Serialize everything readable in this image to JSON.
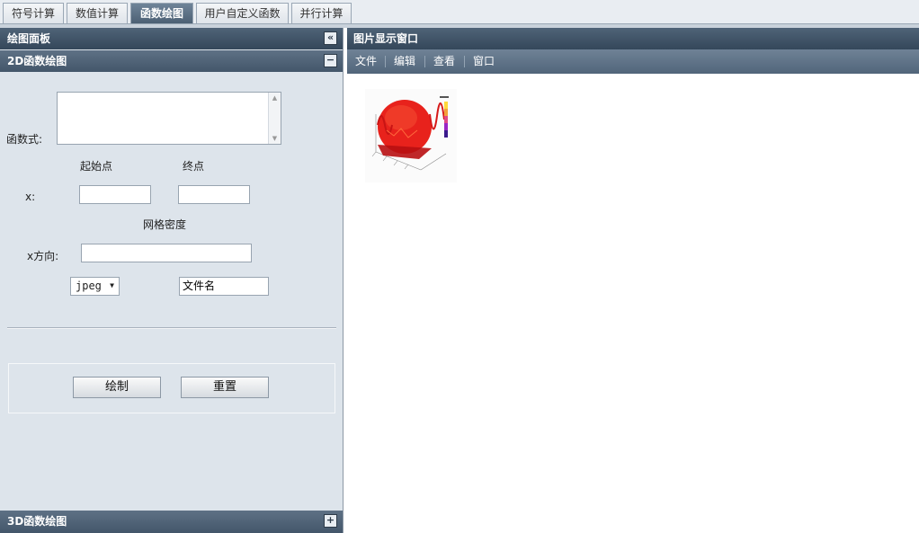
{
  "tabs": [
    "符号计算",
    "数值计算",
    "函数绘图",
    "用户自定义函数",
    "并行计算"
  ],
  "active_tab": "函数绘图",
  "left_panel": {
    "title": "绘图面板",
    "section_2d": {
      "title": "2D函数绘图",
      "function_label": "函数式:",
      "function_value": "",
      "start_label": "起始点",
      "end_label": "终点",
      "x_label": "x:",
      "x_start": "",
      "x_end": "",
      "grid_label": "网格密度",
      "x_dir_label": "x方向:",
      "x_dir_value": "",
      "format_value": "jpeg",
      "filename_value": "文件名",
      "draw_button": "绘制",
      "reset_button": "重置"
    },
    "section_3d": {
      "title": "3D函数绘图"
    }
  },
  "right_panel": {
    "title": "图片显示窗口",
    "menu": [
      "文件",
      "编辑",
      "查看",
      "窗口"
    ]
  },
  "icons": {
    "collapse": "double-chevron-left-icon",
    "minimize": "minus-icon",
    "expand": "plus-icon",
    "dropdown": "triangle-down-icon",
    "scroll_up": "triangle-up-icon",
    "scroll_down": "triangle-down-icon"
  },
  "colors": {
    "header_bg": "#34475a",
    "panel_bg": "#dde4eb",
    "active_tab_bg": "#4c6074",
    "plot_red": "#e8221c"
  }
}
